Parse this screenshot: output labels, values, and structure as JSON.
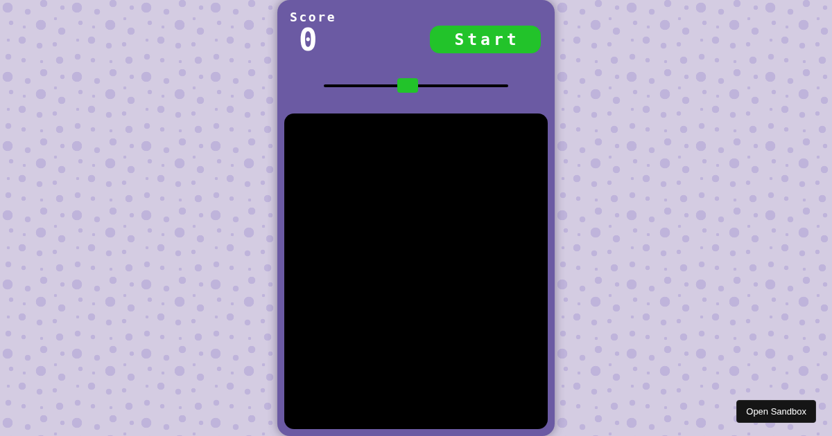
{
  "score": {
    "label": "Score",
    "value": "0"
  },
  "start_button": {
    "label": "Start"
  },
  "slider": {
    "level": 0.45
  },
  "sandbox_button": {
    "label": "Open Sandbox"
  }
}
